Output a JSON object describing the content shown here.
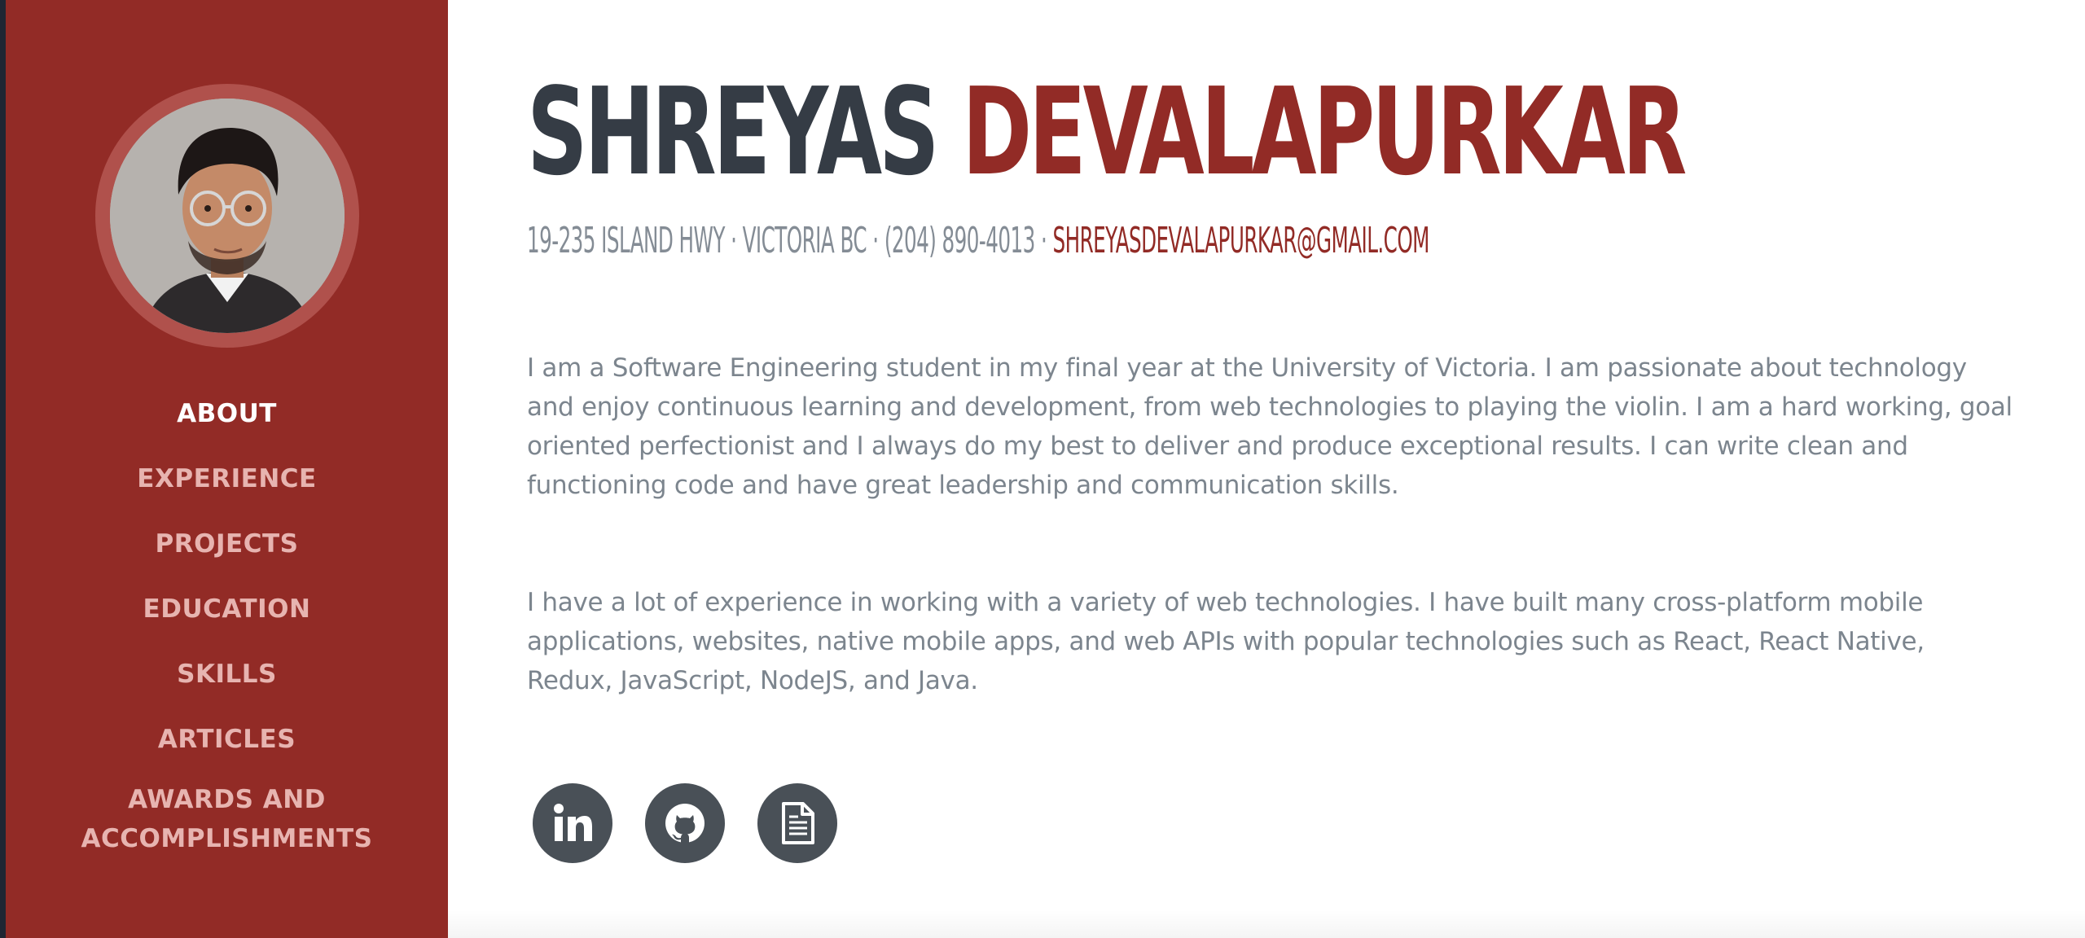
{
  "sidebar": {
    "nav": [
      {
        "label": "ABOUT"
      },
      {
        "label": "EXPERIENCE"
      },
      {
        "label": "PROJECTS"
      },
      {
        "label": "EDUCATION"
      },
      {
        "label": "SKILLS"
      },
      {
        "label": "ARTICLES"
      },
      {
        "label": "AWARDS AND ACCOMPLISHMENTS"
      }
    ],
    "active_item": "ABOUT"
  },
  "header": {
    "first_name": "SHREYAS",
    "last_name": "DEVALAPURKAR",
    "address": "19-235 ISLAND HWY · VICTORIA BC · (204) 890-4013 ·",
    "email": "SHREYASDEVALAPURKAR@GMAIL.COM"
  },
  "about": {
    "paragraphs": [
      "I am a Software Engineering student in my final year at the University of Victoria. I am passionate about technology and enjoy continuous learning and development, from web technologies to playing the violin. I am a hard working, goal oriented perfectionist and I always do my best to deliver and produce exceptional results. I can write clean and functioning code and have great leadership and communication skills.",
      "I have a lot of experience in working with a variety of web technologies. I have built many cross-platform mobile applications, websites, native mobile apps, and web APIs with popular technologies such as React, React Native, Redux, JavaScript, NodeJS, and Java."
    ]
  },
  "socials": [
    {
      "icon": "linkedin-icon"
    },
    {
      "icon": "github-icon"
    },
    {
      "icon": "document-icon"
    }
  ],
  "colors": {
    "sidebar": "#922b26",
    "accent": "#922b26",
    "name_dark": "#353c45",
    "text_muted": "#7c858e",
    "social_bg": "#495057"
  }
}
